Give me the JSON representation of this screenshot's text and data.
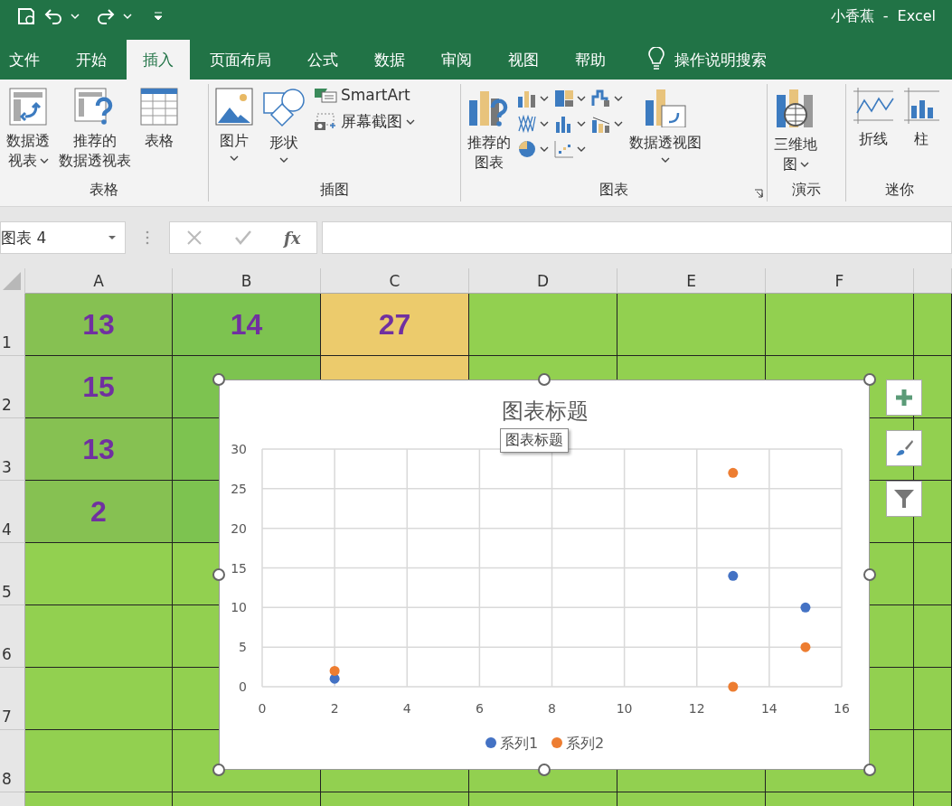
{
  "title_bar": {
    "title": "小香蕉  -  Excel"
  },
  "tabs": [
    {
      "label": "文件",
      "selected": false
    },
    {
      "label": "开始",
      "selected": false
    },
    {
      "label": "插入",
      "selected": true
    },
    {
      "label": "页面布局",
      "selected": false
    },
    {
      "label": "公式",
      "selected": false
    },
    {
      "label": "数据",
      "selected": false
    },
    {
      "label": "审阅",
      "selected": false
    },
    {
      "label": "视图",
      "selected": false
    },
    {
      "label": "帮助",
      "selected": false
    }
  ],
  "search": {
    "label": "操作说明搜索"
  },
  "ribbon": {
    "groups": [
      {
        "label": "表格",
        "items": [
          {
            "lines": [
              "数据透",
              "视表"
            ],
            "dropdown": true
          },
          {
            "lines": [
              "推荐的",
              "数据透视表"
            ],
            "dropdown": false
          },
          {
            "lines": [
              "表格"
            ],
            "dropdown": false
          }
        ]
      },
      {
        "label": "插图",
        "items": [
          {
            "lines": [
              "图片"
            ],
            "dropdown": true
          },
          {
            "lines": [
              "形状"
            ],
            "dropdown": true
          },
          {
            "lines": [
              "SmartArt"
            ],
            "dropdown": false
          },
          {
            "lines": [
              "屏幕截图"
            ],
            "dropdown": true
          }
        ]
      },
      {
        "label": "图表",
        "items": [
          {
            "lines": [
              "推荐的",
              "图表"
            ],
            "dropdown": false
          },
          {
            "lines": [
              "数据透视图"
            ],
            "dropdown": true
          }
        ]
      },
      {
        "label": "演示",
        "items": [
          {
            "lines": [
              "三维地",
              "图"
            ],
            "dropdown": true
          }
        ]
      },
      {
        "label": "迷你",
        "items": [
          {
            "lines": [
              "折线"
            ],
            "dropdown": false
          },
          {
            "lines": [
              "柱"
            ],
            "dropdown": false
          }
        ]
      }
    ]
  },
  "formula_bar": {
    "name_box": "图表 4",
    "function_label": "fx"
  },
  "sheet": {
    "columns": [
      "A",
      "B",
      "C",
      "D",
      "E",
      "F"
    ],
    "rows": [
      {
        "label": "1",
        "cells": [
          {
            "value": "13",
            "color": "#86c152"
          },
          {
            "value": "14",
            "color": "#7dc350"
          },
          {
            "value": "27",
            "color": "#eccb6c"
          },
          {},
          {},
          {}
        ]
      },
      {
        "label": "2",
        "cells": [
          {
            "value": "15",
            "color": "#86c152"
          },
          {
            "color": "#7dc350"
          },
          {
            "color": "#eccb6c"
          },
          {},
          {},
          {}
        ]
      },
      {
        "label": "3",
        "cells": [
          {
            "value": "13",
            "color": "#86c152"
          },
          {
            "color": "#7dc350"
          },
          {},
          {},
          {},
          {}
        ]
      },
      {
        "label": "4",
        "cells": [
          {
            "value": "2",
            "color": "#86c152"
          },
          {
            "color": "#7dc350"
          },
          {},
          {},
          {},
          {}
        ]
      },
      {
        "label": "5",
        "cells": [
          {},
          {},
          {},
          {},
          {},
          {}
        ]
      },
      {
        "label": "6",
        "cells": [
          {},
          {},
          {},
          {},
          {},
          {}
        ]
      },
      {
        "label": "7",
        "cells": [
          {},
          {},
          {},
          {},
          {},
          {}
        ]
      },
      {
        "label": "8",
        "cells": [
          {},
          {},
          {},
          {},
          {},
          {}
        ]
      }
    ]
  },
  "chart": {
    "tooltip": "图表标题",
    "chart_data": {
      "type": "scatter",
      "title": "图表标题",
      "x": [
        13,
        15,
        13,
        2
      ],
      "series": [
        {
          "name": "系列1",
          "color": "#4472c4",
          "values": [
            14,
            10,
            null,
            1
          ]
        },
        {
          "name": "系列2",
          "color": "#ed7d31",
          "values": [
            27,
            5,
            0,
            2
          ]
        }
      ],
      "xlim": [
        0,
        16
      ],
      "ylim": [
        0,
        30
      ],
      "xticks": [
        0,
        2,
        4,
        6,
        8,
        10,
        12,
        14,
        16
      ],
      "yticks": [
        0,
        5,
        10,
        15,
        20,
        25,
        30
      ],
      "grid": true,
      "legend": true
    }
  }
}
